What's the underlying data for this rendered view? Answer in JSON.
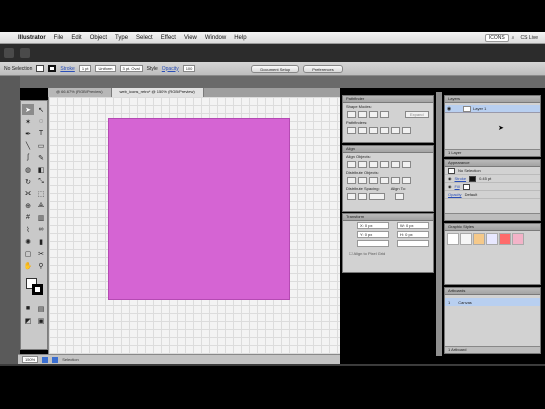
{
  "menubar": {
    "items": [
      "Illustrator",
      "File",
      "Edit",
      "Object",
      "Type",
      "Select",
      "Effect",
      "View",
      "Window",
      "Help"
    ],
    "workspace": "ICONS",
    "user": "CS Live"
  },
  "controlbar": {
    "selection_label": "No Selection",
    "stroke_label": "Stroke",
    "stroke_weight": "1 pt",
    "stroke_profile": "Uniform",
    "brush": "3 pt. Oval",
    "style_label": "Style",
    "opacity_label": "Opacity",
    "opacity_value": "100",
    "document_setup": "Document Setup",
    "preferences": "Preferences"
  },
  "tabs": [
    {
      "label": "@ 66.67% (RGB/Preview)",
      "active": false
    },
    {
      "label": "web_icons_retro* @ 150% (RGB/Preview)",
      "active": true
    }
  ],
  "statusbar": {
    "zoom": "150%",
    "status": "Selection"
  },
  "pathfinder": {
    "title": "Pathfinder",
    "shape_modes": "Shape Modes:",
    "expand": "Expand",
    "pathfinders": "Pathfinders:"
  },
  "align": {
    "title": "Align",
    "align_objects": "Align Objects:",
    "distribute_objects": "Distribute Objects:",
    "distribute_spacing": "Distribute Spacing:",
    "align_to": "Align To:"
  },
  "transform": {
    "title": "Transform",
    "x_label": "X:",
    "x_value": "0 px",
    "w_label": "W:",
    "w_value": "0 px",
    "y_label": "Y:",
    "y_value": "0 px",
    "h_label": "H:",
    "h_value": "0 px",
    "align_pixel": "Align to Pixel Grid"
  },
  "layers": {
    "title": "Layers",
    "layer_name": "Layer 1",
    "footer": "1 Layer"
  },
  "appearance": {
    "title": "Appearance",
    "no_selection": "No Selection",
    "stroke": "Stroke",
    "stroke_value": "0.45 pt",
    "fill": "Fill",
    "opacity": "Opacity",
    "opacity_value": "Default"
  },
  "library": {
    "title": "Graphic Styles",
    "swatch_colors": [
      "#ffffff",
      "#f7f7f7",
      "#f5c98a",
      "#e8e8ff",
      "#ff6b6b",
      "#f3b3c8"
    ]
  },
  "artboards": {
    "title": "Artboards",
    "index": "1",
    "name": "Canvas",
    "footer": "1 Artboard"
  },
  "artwork": {
    "fill_color": "#d564d3"
  }
}
